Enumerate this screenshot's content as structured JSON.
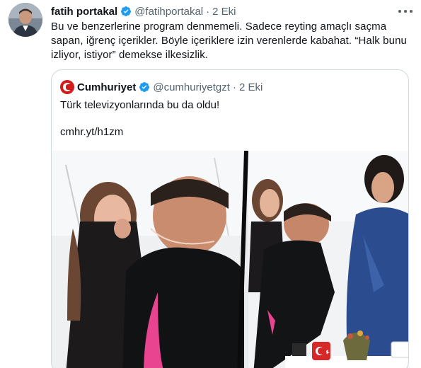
{
  "tweet": {
    "author_name": "fatih portakal",
    "handle": "@fatihportakal",
    "separator": "·",
    "date": "2 Eki",
    "text": "Bu ve benzerlerine program denmemeli. Sadece reyting amaçlı saçma sapan, iğrenç içerikler. Böyle içeriklere izin verenlerde kabahat. “Halk bunu izliyor, istiyor” demekse ilkesizlik.",
    "icons": {
      "avatar": "profile-photo",
      "verified": "verified-badge-icon",
      "more": "more-options-icon"
    }
  },
  "quoted": {
    "author_name": "Cumhuriyet",
    "handle": "@cumhuriyetgzt",
    "separator": "·",
    "date": "2 Eki",
    "text": "Türk televizyonlarında bu da oldu!",
    "link": "cmhr.yt/h1zm",
    "media": "video-thumbnail-tv-studio"
  },
  "colors": {
    "verified": "#1d9bf0",
    "secondary_text": "#536471",
    "border": "#cfd9de",
    "brand_red": "#d51a1a"
  }
}
